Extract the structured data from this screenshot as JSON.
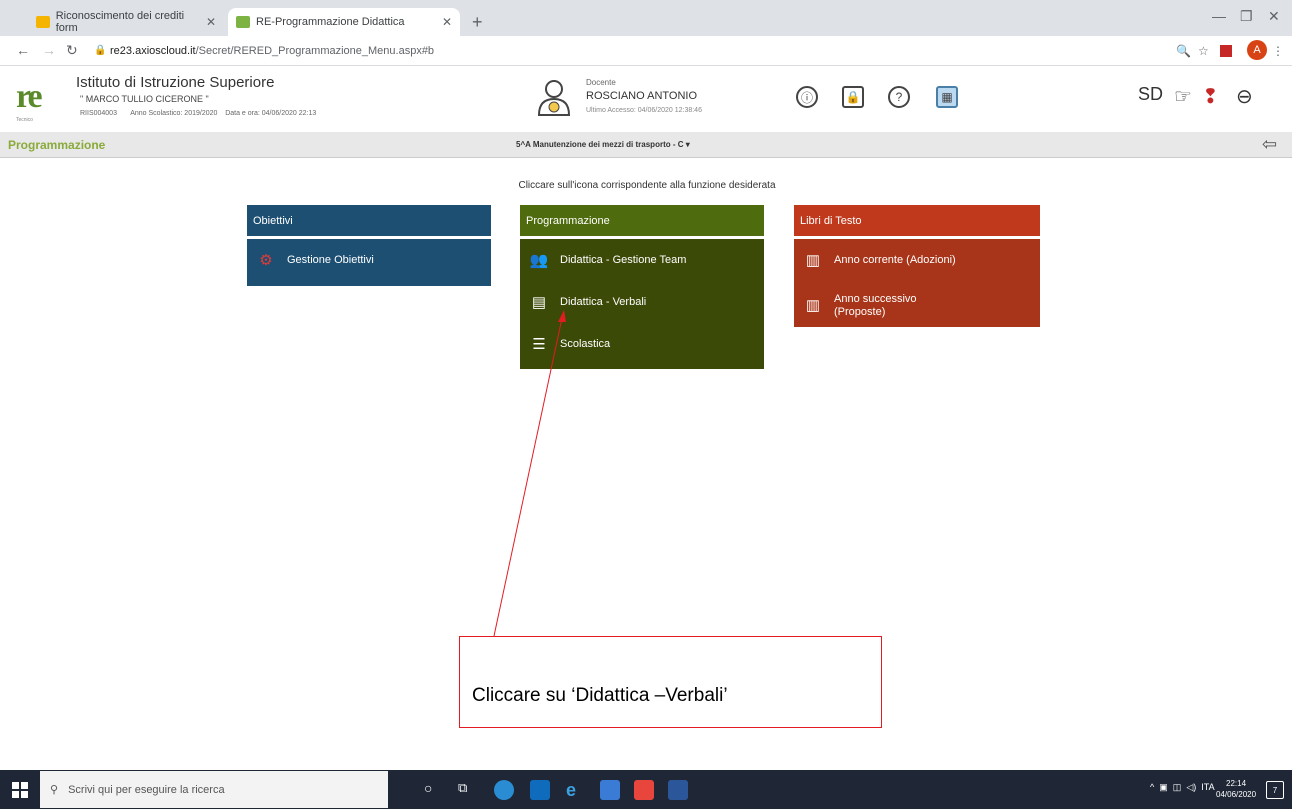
{
  "browser": {
    "tabs": [
      {
        "label": "Riconoscimento dei crediti form",
        "active": false
      },
      {
        "label": "RE-Programmazione Didattica",
        "active": true
      }
    ],
    "url_host": "re23.axioscloud.it",
    "url_path": "/Secret/RERED_Programmazione_Menu.aspx#b",
    "profile_initial": "A"
  },
  "header": {
    "logo": "re",
    "logo_sub": "Tecnico",
    "school_name": "Istituto di Istruzione Superiore",
    "school_sub": "\" MARCO TULLIO CICERONE \"",
    "school_code": "RIIS004003",
    "school_year": "Anno Scolastico: 2019/2020",
    "date_time": "Data e ora: 04/06/2020 22:13",
    "user_role": "Docente",
    "user_name": "ROSCIANO ANTONIO",
    "last_access": "Ultimo Accesso: 04/06/2020 12:38:46"
  },
  "subbar": {
    "title": "Programmazione",
    "class_selector": "5^A Manutenzione dei mezzi di trasporto - C ▾"
  },
  "instruction": "Cliccare sull'icona corrispondente alla funzione desiderata",
  "panels": {
    "obiettivi": {
      "title": "Obiettivi",
      "items": [
        "Gestione Obiettivi"
      ]
    },
    "programmazione": {
      "title": "Programmazione",
      "items": [
        "Didattica - Gestione Team",
        "Didattica - Verbali",
        "Scolastica"
      ]
    },
    "libri": {
      "title": "Libri di Testo",
      "items": [
        "Anno corrente (Adozioni)",
        "Anno successivo (Proposte)"
      ]
    }
  },
  "callout": {
    "text": "Cliccare su ‘Didattica –Verbali’",
    "color": "#e31b23"
  },
  "taskbar": {
    "search_placeholder": "Scrivi qui per eseguire la ricerca",
    "lang": "ITA",
    "time": "22:14",
    "date": "04/06/2020",
    "notifications": "7"
  },
  "colors": {
    "obiettivi": "#1d4f73",
    "programmazione": "#4e6b0d",
    "libri": "#c0391c"
  }
}
